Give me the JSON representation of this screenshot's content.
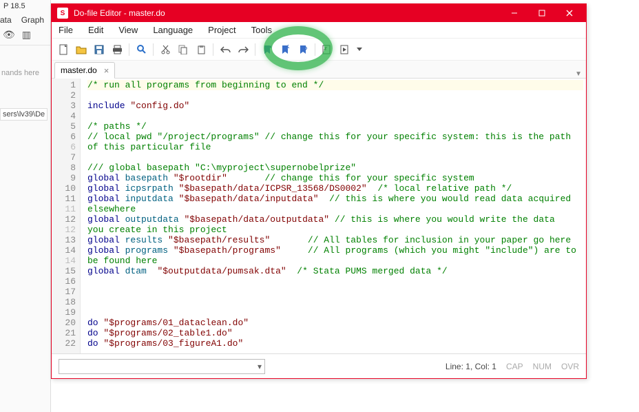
{
  "background": {
    "app_fragment": "P 18.5",
    "tabs": [
      "ata",
      "Graph"
    ],
    "hint": "nands here",
    "path_fragment": "sers\\lv39\\De"
  },
  "window": {
    "title": "Do-file Editor - master.do",
    "menu": [
      "File",
      "Edit",
      "View",
      "Language",
      "Project",
      "Tools"
    ],
    "tab_name": "master.do",
    "status": {
      "pos": "Line: 1, Col: 1",
      "cap": "CAP",
      "num": "NUM",
      "ovr": "OVR"
    }
  },
  "code": {
    "lines": [
      {
        "n": "1",
        "hl": true,
        "tokens": [
          [
            "cmt",
            "/* run all programs from beginning to end */"
          ]
        ]
      },
      {
        "n": "2",
        "tokens": []
      },
      {
        "n": "3",
        "tokens": [
          [
            "kw",
            "include"
          ],
          [
            "txt",
            " "
          ],
          [
            "str",
            "\"config.do\""
          ]
        ]
      },
      {
        "n": "4",
        "tokens": []
      },
      {
        "n": "5",
        "tokens": [
          [
            "cmt",
            "/* paths */"
          ]
        ]
      },
      {
        "n": "6",
        "tokens": [
          [
            "cmt",
            "// local pwd \"/project/programs\" // change this for your specific system: this is the path"
          ]
        ]
      },
      {
        "n": "6",
        "wrap": true,
        "tokens": [
          [
            "cmt",
            "of this particular file"
          ]
        ]
      },
      {
        "n": "7",
        "tokens": []
      },
      {
        "n": "8",
        "tokens": [
          [
            "cmt",
            "/// global basepath \"C:\\myproject\\supernobelprize\""
          ]
        ]
      },
      {
        "n": "9",
        "tokens": [
          [
            "kw",
            "global"
          ],
          [
            "txt",
            " "
          ],
          [
            "id",
            "basepath"
          ],
          [
            "txt",
            " "
          ],
          [
            "str",
            "\"$rootdir\""
          ],
          [
            "txt",
            "       "
          ],
          [
            "cmt",
            "// change this for your specific system"
          ]
        ]
      },
      {
        "n": "10",
        "tokens": [
          [
            "kw",
            "global"
          ],
          [
            "txt",
            " "
          ],
          [
            "id",
            "icpsrpath"
          ],
          [
            "txt",
            " "
          ],
          [
            "str",
            "\"$basepath/data/ICPSR_13568/DS0002\""
          ],
          [
            "txt",
            "  "
          ],
          [
            "cmt",
            "/* local relative path */"
          ]
        ]
      },
      {
        "n": "11",
        "tokens": [
          [
            "kw",
            "global"
          ],
          [
            "txt",
            " "
          ],
          [
            "id",
            "inputdata"
          ],
          [
            "txt",
            " "
          ],
          [
            "str",
            "\"$basepath/data/inputdata\""
          ],
          [
            "txt",
            "  "
          ],
          [
            "cmt",
            "// this is where you would read data acquired"
          ]
        ]
      },
      {
        "n": "11",
        "wrap": true,
        "tokens": [
          [
            "cmt",
            "elsewhere"
          ]
        ]
      },
      {
        "n": "12",
        "tokens": [
          [
            "kw",
            "global"
          ],
          [
            "txt",
            " "
          ],
          [
            "id",
            "outputdata"
          ],
          [
            "txt",
            " "
          ],
          [
            "str",
            "\"$basepath/data/outputdata\""
          ],
          [
            "txt",
            " "
          ],
          [
            "cmt",
            "// this is where you would write the data"
          ]
        ]
      },
      {
        "n": "12",
        "wrap": true,
        "tokens": [
          [
            "cmt",
            "you create in this project"
          ]
        ]
      },
      {
        "n": "13",
        "tokens": [
          [
            "kw",
            "global"
          ],
          [
            "txt",
            " "
          ],
          [
            "id",
            "results"
          ],
          [
            "txt",
            " "
          ],
          [
            "str",
            "\"$basepath/results\""
          ],
          [
            "txt",
            "       "
          ],
          [
            "cmt",
            "// All tables for inclusion in your paper go here"
          ]
        ]
      },
      {
        "n": "14",
        "tokens": [
          [
            "kw",
            "global"
          ],
          [
            "txt",
            " "
          ],
          [
            "id",
            "programs"
          ],
          [
            "txt",
            " "
          ],
          [
            "str",
            "\"$basepath/programs\""
          ],
          [
            "txt",
            "     "
          ],
          [
            "cmt",
            "// All programs (which you might \"include\") are to"
          ]
        ]
      },
      {
        "n": "14",
        "wrap": true,
        "tokens": [
          [
            "cmt",
            "be found here"
          ]
        ]
      },
      {
        "n": "15",
        "tokens": [
          [
            "kw",
            "global"
          ],
          [
            "txt",
            " "
          ],
          [
            "id",
            "dtam"
          ],
          [
            "txt",
            "  "
          ],
          [
            "str",
            "\"$outputdata/pumsak.dta\""
          ],
          [
            "txt",
            "  "
          ],
          [
            "cmt",
            "/* Stata PUMS merged data */"
          ]
        ]
      },
      {
        "n": "16",
        "tokens": []
      },
      {
        "n": "17",
        "tokens": []
      },
      {
        "n": "18",
        "tokens": []
      },
      {
        "n": "19",
        "tokens": []
      },
      {
        "n": "20",
        "tokens": [
          [
            "kw",
            "do"
          ],
          [
            "txt",
            " "
          ],
          [
            "str",
            "\"$programs/01_dataclean.do\""
          ]
        ]
      },
      {
        "n": "21",
        "tokens": [
          [
            "kw",
            "do"
          ],
          [
            "txt",
            " "
          ],
          [
            "str",
            "\"$programs/02_table1.do\""
          ]
        ]
      },
      {
        "n": "22",
        "tokens": [
          [
            "kw",
            "do"
          ],
          [
            "txt",
            " "
          ],
          [
            "str",
            "\"$programs/03_figureA1.do\""
          ]
        ]
      }
    ]
  }
}
